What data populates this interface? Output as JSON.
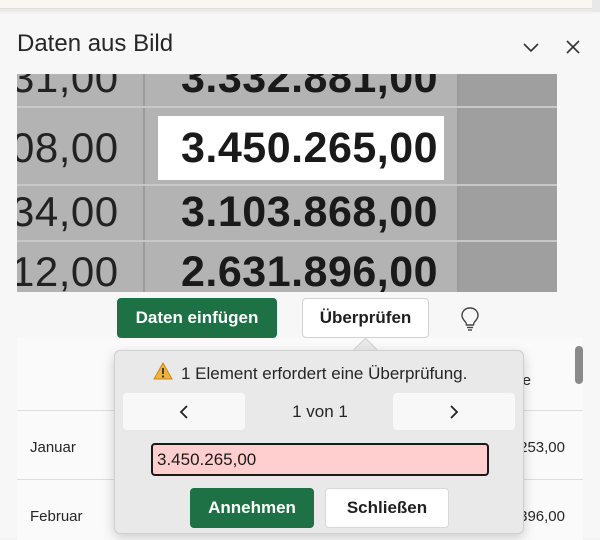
{
  "pane": {
    "title": "Daten aus Bild",
    "collapse_icon": "chevron-down-icon",
    "close_icon": "close-icon"
  },
  "picture": {
    "rows": [
      {
        "left": "31,00",
        "right": "3.332.881,00"
      },
      {
        "left": "08,00",
        "right": "3.450.265,00"
      },
      {
        "left": "34,00",
        "right": "3.103.868,00"
      },
      {
        "left": "12,00",
        "right": "2.631.896,00"
      }
    ]
  },
  "actions": {
    "insert_label": "Daten einfügen",
    "review_label": "Überprüfen",
    "idea_icon": "lightbulb-icon"
  },
  "table": {
    "header_fragment": "e",
    "rows": [
      {
        "label": "Januar",
        "value": "253,00"
      },
      {
        "label": "Februar",
        "value": "396,00"
      }
    ]
  },
  "review": {
    "warning_icon": "warning-icon",
    "message": "1 Element erfordert eine Überprüfung.",
    "counter": "1 von 1",
    "prev_icon": "chevron-left-icon",
    "next_icon": "chevron-right-icon",
    "value": "3.450.265,00",
    "accept_label": "Annehmen",
    "close_label": "Schließen"
  },
  "colors": {
    "accent": "#1e7145",
    "error_field": "#ffcfcf",
    "warning": "#e8a317"
  }
}
